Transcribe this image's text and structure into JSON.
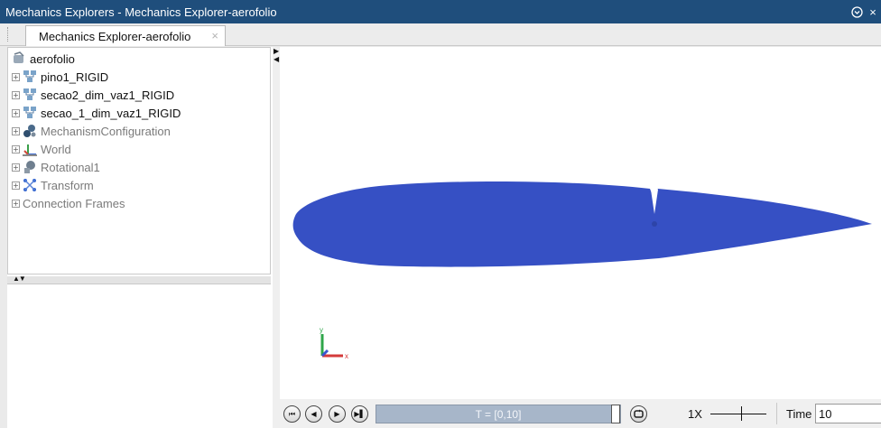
{
  "window": {
    "title": "Mechanics Explorers - Mechanics Explorer-aerofolio",
    "menu_icon": "circle-chevron-down-icon",
    "close_glyph": "×"
  },
  "tabs": [
    {
      "label": "Mechanics Explorer-aerofolio",
      "close_glyph": "×"
    }
  ],
  "tree": {
    "root": {
      "label": "aerofolio",
      "icon": "model-icon"
    },
    "items": [
      {
        "label": "pino1_RIGID",
        "icon": "rigid-body-icon",
        "expander": "+",
        "enabled": true
      },
      {
        "label": "secao2_dim_vaz1_RIGID",
        "icon": "rigid-body-icon",
        "expander": "+",
        "enabled": true
      },
      {
        "label": "secao_1_dim_vaz1_RIGID",
        "icon": "rigid-body-icon",
        "expander": "+",
        "enabled": true
      },
      {
        "label": "MechanismConfiguration",
        "icon": "mechanism-configuration-icon",
        "expander": "+",
        "enabled": false
      },
      {
        "label": "World",
        "icon": "world-frame-icon",
        "expander": "+",
        "enabled": false
      },
      {
        "label": "Rotational1",
        "icon": "revolute-joint-icon",
        "expander": "+",
        "enabled": false
      },
      {
        "label": "Transform",
        "icon": "transform-icon",
        "expander": "+",
        "enabled": false
      },
      {
        "label": "Connection Frames",
        "icon": "",
        "expander": "+",
        "enabled": false
      }
    ]
  },
  "viewport": {
    "background": "#ffffff",
    "body_color": "#3650c4",
    "triad": {
      "x_label": "x",
      "y_label": "y"
    }
  },
  "playback": {
    "buttons": [
      {
        "name": "rewind-button",
        "glyph": "⏮"
      },
      {
        "name": "step-back-button",
        "glyph": "◀"
      },
      {
        "name": "play-button",
        "glyph": "▶"
      },
      {
        "name": "step-forward-button",
        "glyph": "▶▌"
      }
    ],
    "time_range_label": "T = [0,10]",
    "progress": 1.0,
    "speed_label": "1X",
    "time_label": "Time",
    "time_value": "10"
  }
}
